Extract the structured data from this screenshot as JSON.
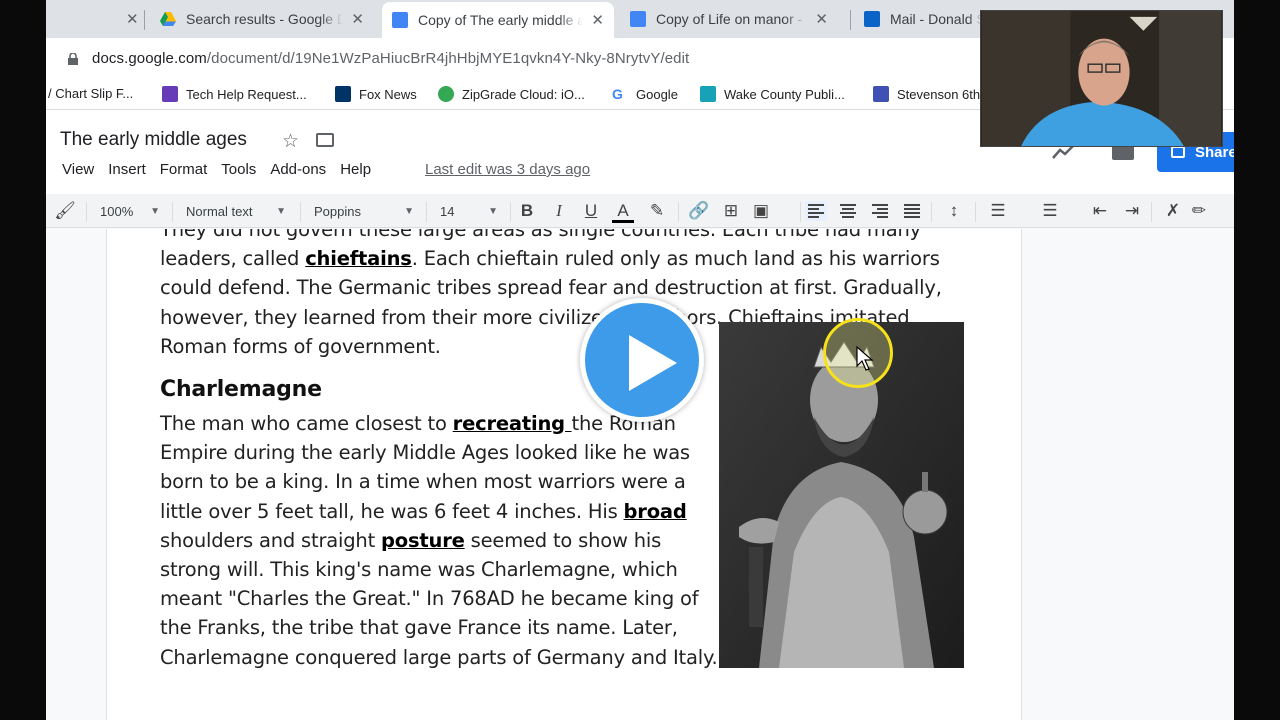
{
  "browser": {
    "tabs": [
      {
        "title": "Search results - Google Drive",
        "favicon": "google-drive-icon",
        "active": false
      },
      {
        "title": "Copy of The early middle ages",
        "favicon": "google-docs-icon",
        "active": true
      },
      {
        "title": "Copy of Life on manor - Google Docs",
        "favicon": "google-docs-icon",
        "active": false
      },
      {
        "title": "Mail - Donald S",
        "favicon": "outlook-icon",
        "active": false
      }
    ],
    "url_host": "docs.google.com",
    "url_path": "/document/d/19Ne1WzPaHiucBrR4jhHbjMYE1qvkn4Y-Nky-8NrytvY/edit",
    "bookmarks": [
      "/ Chart Slip F...",
      "Tech Help Request...",
      "Fox News",
      "ZipGrade Cloud: iO...",
      "Google",
      "Wake County Publi...",
      "Stevenson 6th"
    ]
  },
  "docs": {
    "title": "The early middle ages",
    "menu": [
      "View",
      "Insert",
      "Format",
      "Tools",
      "Add-ons",
      "Help"
    ],
    "last_edit": "Last edit was 3 days ago",
    "share_label": "Share",
    "toolbar": {
      "zoom": "100%",
      "style": "Normal text",
      "font": "Poppins",
      "size": "14"
    }
  },
  "content": {
    "p1_a": "They did not govern these large areas as single countries. Each tribe had many leaders, called ",
    "p1_kw": "chieftains",
    "p1_b": ". Each chieftain ruled only as much land as his warriors could defend. The Germanic tribes spread fear and destruction at first. Gradually, however, they learned from their more civilized neighbors. Chieftains imitated Roman forms of government.",
    "heading": "Charlemagne",
    "p2_a": "The man who came closest to ",
    "p2_kw1": "recreating ",
    "p2_b": "the Roman Empire during the early Middle Ages looked like he was born to be a king. In a time when most warriors were a little over 5 feet tall, he was 6 feet 4 inches. His ",
    "p2_kw2": "broad ",
    "p2_c": "shoulders and straight ",
    "p2_kw3": "posture",
    "p2_d": " seemed to show his strong will. This king's name was Charlemagne, which meant \"Charles the Great.\" In 768AD he became king of the Franks, the tribe that gave France its name. Later, Charlemagne conquered large parts of Germany and Italy."
  },
  "colors": {
    "share": "#1a73e8",
    "play": "#3d9be9",
    "cursor_ring": "#f6e11b"
  }
}
